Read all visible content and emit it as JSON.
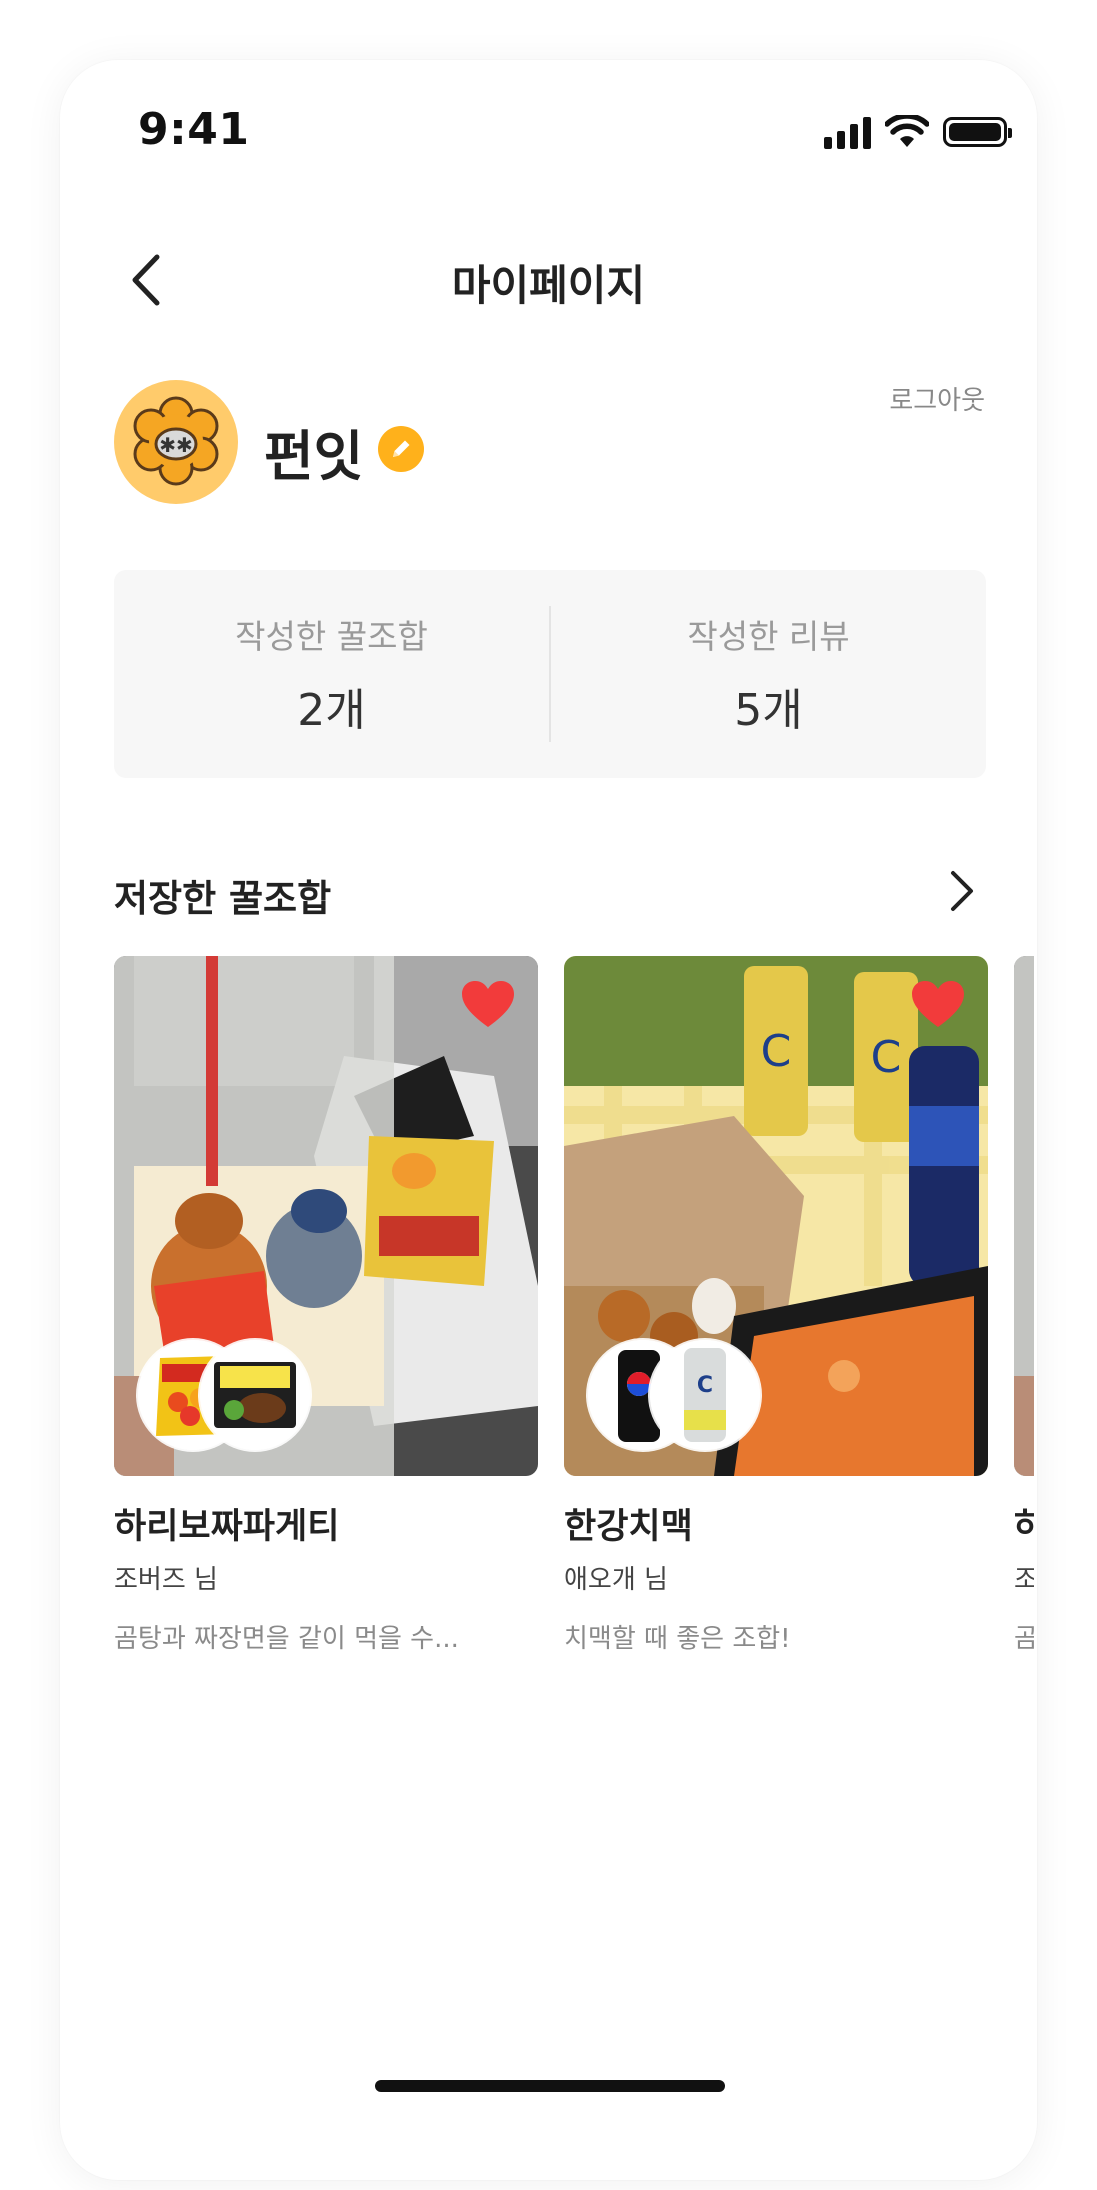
{
  "status": {
    "time": "9:41",
    "battery_level": 1.0
  },
  "header": {
    "title": "마이페이지",
    "back_icon": "chevron-left-icon"
  },
  "profile": {
    "nickname": "펀잇",
    "logout_label": "로그아웃",
    "avatar_icon": "flower-character-avatar",
    "edit_icon": "pencil-icon",
    "edit_color": "#FFB11B"
  },
  "stats": [
    {
      "label": "작성한 꿀조합",
      "value": "2개"
    },
    {
      "label": "작성한 리뷰",
      "value": "5개"
    }
  ],
  "saved": {
    "title": "저장한 꿀조합",
    "arrow_icon": "chevron-right-icon",
    "cards": [
      {
        "title": "하리보짜파게티",
        "author": "조버즈 님",
        "description": "곰탕과 짜장면을 같이 먹을 수...",
        "liked": true
      },
      {
        "title": "한강치맥",
        "author": "애오개 님",
        "description": "치맥할 때 좋은 조합!",
        "liked": true
      },
      {
        "title": "하리보짜파게티",
        "author": "조버즈 님",
        "description": "곰탕과 짜장면을 같이 먹을 수...",
        "liked": true
      }
    ]
  },
  "colors": {
    "accent": "#FFB11B",
    "heart": "#F23B3B",
    "stats_bg": "#F7F7F7"
  }
}
